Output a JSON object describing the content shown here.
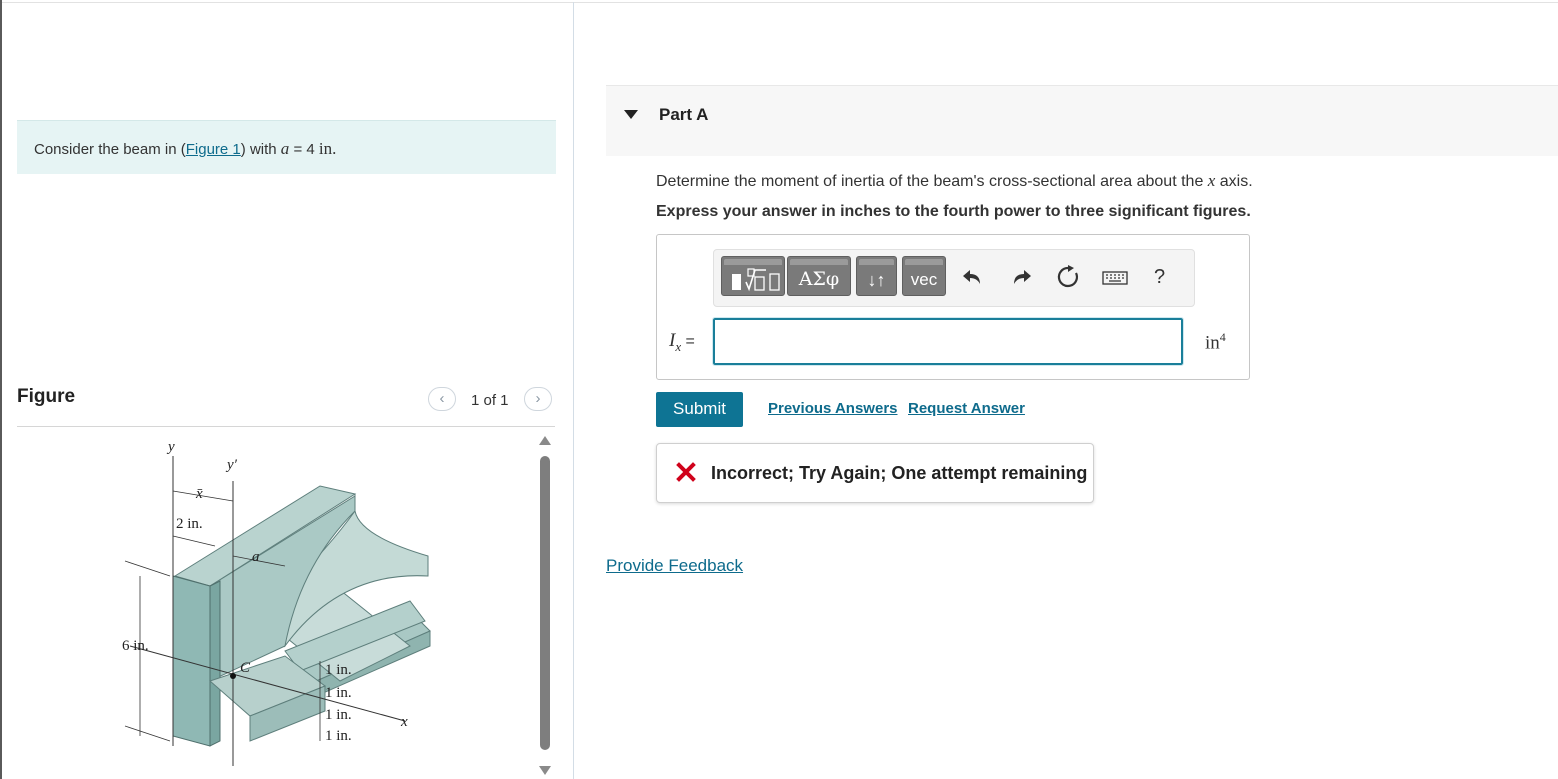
{
  "intro": {
    "prefix": "Consider the beam in (",
    "link": "Figure 1",
    "middle": ") with ",
    "var": "a",
    "eq": " = 4 ",
    "unit": "in."
  },
  "figure": {
    "title": "Figure",
    "pager": "1 of 1",
    "prev_icon": "chevron-left-icon",
    "next_icon": "chevron-right-icon",
    "labels": {
      "y": "y",
      "y_prime": "y′",
      "x_bar": "x̄",
      "two_in": "2 in.",
      "a": "a",
      "six_in": "6 in.",
      "c": "C",
      "one_in_1": "1 in.",
      "one_in_2": "1 in.",
      "one_in_3": "1 in.",
      "one_in_4": "1 in.",
      "x": "x"
    },
    "colors": {
      "beam_front": "#8fb8b4",
      "beam_top": "#b9d3cf",
      "beam_side": "#a6c5c1"
    }
  },
  "part_a": {
    "title": "Part A",
    "question_prefix": "Determine the moment of inertia of the beam's cross-sectional area about the ",
    "question_var": "x",
    "question_suffix": " axis.",
    "instruction": "Express your answer in inches to the fourth power to three significant figures."
  },
  "toolbar": {
    "templates_icon": "templates-icon",
    "greek_label": "ΑΣφ",
    "arrows_label": "↓↑",
    "vec_label": "vec",
    "undo_icon": "undo-icon",
    "redo_icon": "redo-icon",
    "reset_icon": "reset-icon",
    "keyboard_icon": "keyboard-icon",
    "help_label": "?"
  },
  "answer": {
    "label_var": "I",
    "label_sub": "x",
    "label_eq": " =",
    "value": "",
    "unit_base": "in",
    "unit_exp": "4"
  },
  "actions": {
    "submit": "Submit",
    "previous_answers": "Previous Answers",
    "request_answer": "Request Answer"
  },
  "feedback": {
    "message": "Incorrect; Try Again; One attempt remaining",
    "icon": "x-icon",
    "icon_color": "#d0021b"
  },
  "provide_feedback": "Provide Feedback",
  "colors": {
    "accent": "#0e7494",
    "link": "#0e6b8c",
    "intro_bg": "#e6f4f4"
  }
}
